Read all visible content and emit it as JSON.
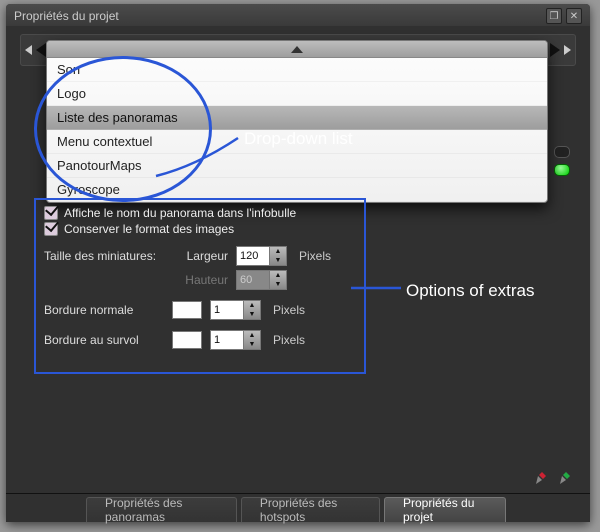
{
  "window": {
    "title": "Propriétés du projet"
  },
  "dropdown": {
    "items": [
      "Son",
      "Logo",
      "Liste des panoramas",
      "Menu contextuel",
      "PanotourMaps",
      "Gyroscope"
    ],
    "hover_index": 2
  },
  "annotations": {
    "dropdown_label": "Drop-down list",
    "options_label": "Options of extras"
  },
  "options": {
    "chk1_label": "Affiche le nom du panorama dans l'infobulle",
    "chk2_label": "Conserver le format des images",
    "thumb_label": "Taille des miniatures:",
    "width_label": "Largeur",
    "height_label": "Hauteur",
    "width_value": "120",
    "height_value": "60",
    "unit": "Pixels",
    "border_normal_label": "Bordure normale",
    "border_normal_value": "1",
    "border_hover_label": "Bordure au survol",
    "border_hover_value": "1"
  },
  "tabs": {
    "t1": "Propriétés des panoramas",
    "t2": "Propriétés des hotspots",
    "t3": "Propriétés du projet"
  },
  "glyphs": {
    "up": "▲",
    "down": "▼",
    "restore": "❐",
    "close": "✕"
  }
}
